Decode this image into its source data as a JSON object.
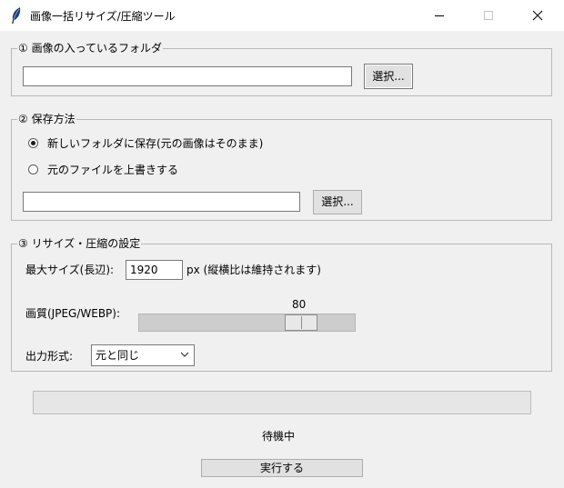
{
  "window": {
    "title": "画像一括リサイズ/圧縮ツール",
    "icon": "feather-icon"
  },
  "folder_section": {
    "legend": "① 画像の入っているフォルダ",
    "path_value": "",
    "select_button": "選択..."
  },
  "save_section": {
    "legend": "② 保存方法",
    "options": [
      {
        "label": "新しいフォルダに保存(元の画像はそのまま)",
        "checked": true
      },
      {
        "label": "元のファイルを上書きする",
        "checked": false
      }
    ],
    "path_value": "",
    "select_button": "選択..."
  },
  "settings_section": {
    "legend": "③ リサイズ・圧縮の設定",
    "max_size_label": "最大サイズ(長辺):",
    "max_size_value": "1920",
    "max_size_suffix": "px (縦横比は維持されます)",
    "quality_label": "画質(JPEG/WEBP):",
    "quality_value": "80",
    "quality_min": 1,
    "quality_max": 100,
    "format_label": "出力形式:",
    "format_value": "元と同じ"
  },
  "progress": {
    "fraction": 0
  },
  "status_text": "待機中",
  "run_button": "実行する",
  "colors": {
    "background": "#f0f0f0",
    "titlebar": "#ffffff",
    "progress_fill": "#06b025"
  }
}
